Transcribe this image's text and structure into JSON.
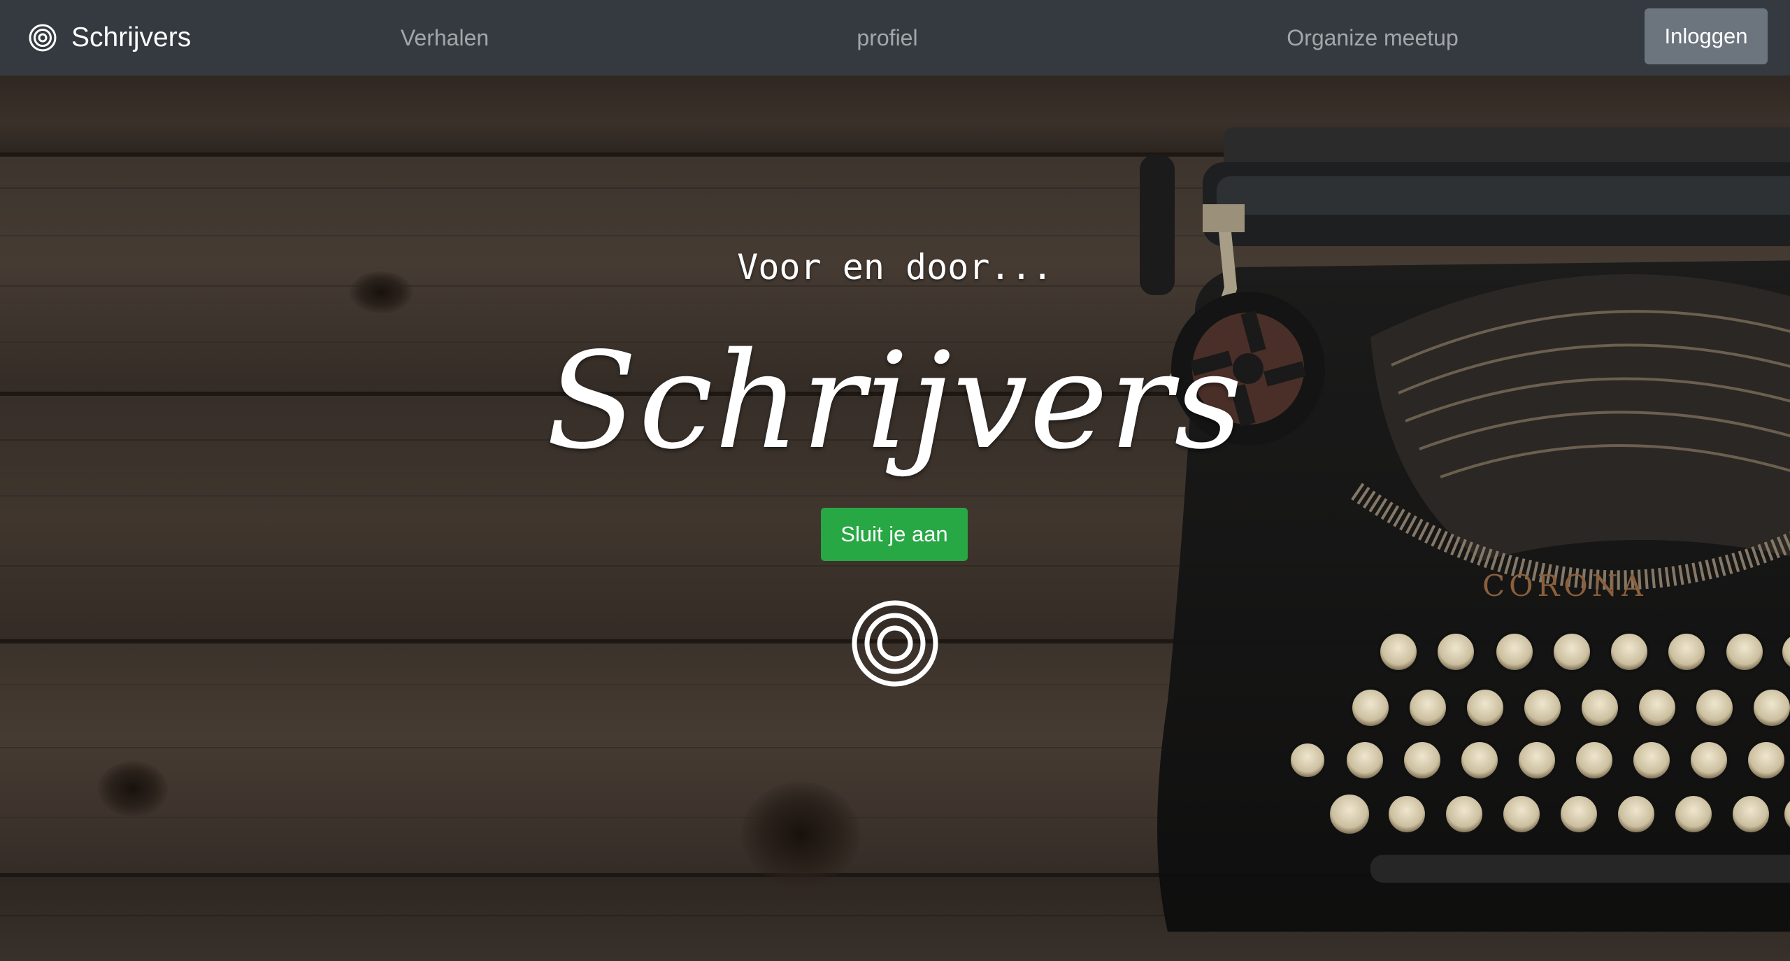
{
  "navbar": {
    "brand_name": "Schrijvers",
    "brand_icon": "concentric-circles-icon",
    "links": [
      {
        "label": "Verhalen"
      },
      {
        "label": "profiel"
      },
      {
        "label": "Organize meetup"
      }
    ],
    "login_label": "Inloggen",
    "background_color": "#343a40",
    "login_color": "#6c757d"
  },
  "hero": {
    "tagline": "Voor en door...",
    "title": "Schrijvers",
    "cta_label": "Sluit je aan",
    "cta_color": "#28a745",
    "logo_icon": "concentric-circles-icon",
    "background_image": "typewriter on dark wooden table",
    "typewriter_brand": "CORONA"
  }
}
